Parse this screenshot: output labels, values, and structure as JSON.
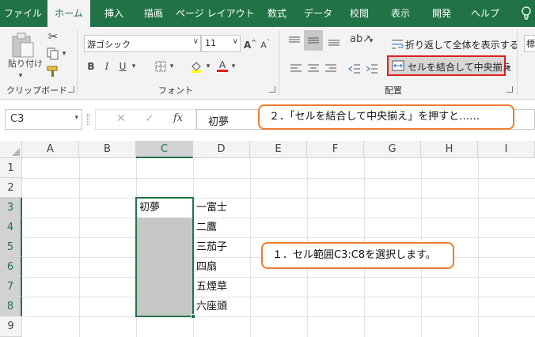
{
  "tabs": [
    {
      "label": "ファイル",
      "active": false
    },
    {
      "label": "ホーム",
      "active": true
    },
    {
      "label": "挿入",
      "active": false
    },
    {
      "label": "描画",
      "active": false
    },
    {
      "label": "ページ レイアウト",
      "active": false
    },
    {
      "label": "数式",
      "active": false
    },
    {
      "label": "データ",
      "active": false
    },
    {
      "label": "校閲",
      "active": false
    },
    {
      "label": "表示",
      "active": false
    },
    {
      "label": "開発",
      "active": false
    },
    {
      "label": "ヘルプ",
      "active": false
    }
  ],
  "ribbon": {
    "clipboard": {
      "paste_label": "貼り付け",
      "group_label": "クリップボード"
    },
    "font": {
      "font_name": "游ゴシック",
      "font_size": "11",
      "grow": "A",
      "shrink": "A",
      "bold": "B",
      "italic": "I",
      "underline": "U",
      "font_color_glyph": "A",
      "group_label": "フォント"
    },
    "alignment": {
      "wrap_text_label": "折り返して全体を表示する",
      "merge_center_label": "セルを結合して中央揃え",
      "group_label": "配置"
    },
    "next_group_partial": "標"
  },
  "formula_bar": {
    "name_box": "C3",
    "fx_label": "fx",
    "formula_value": "初夢"
  },
  "grid": {
    "columns": [
      "A",
      "B",
      "C",
      "D",
      "E",
      "F",
      "G",
      "H",
      "I"
    ],
    "selected_column": "C",
    "rows": [
      "1",
      "2",
      "3",
      "4",
      "5",
      "6",
      "7",
      "8",
      "9"
    ],
    "selected_rows": [
      "3",
      "4",
      "5",
      "6",
      "7",
      "8"
    ],
    "cells": {
      "C3": "初夢",
      "D3": "一富士",
      "D4": "二鷹",
      "D5": "三茄子",
      "D6": "四扇",
      "D7": "五煙草",
      "D8": "六座頭"
    },
    "selection_range": "C3:C8"
  },
  "callouts": {
    "step1": "１．セル範囲C3:C8を選択します。",
    "step2": "２．「セルを結合して中央揃え」を押すと……"
  },
  "colors": {
    "accent": "#217346",
    "selection_fill": "#c6c6c6",
    "highlight_border": "#e0201b",
    "callout_border": "#ed7d31"
  }
}
